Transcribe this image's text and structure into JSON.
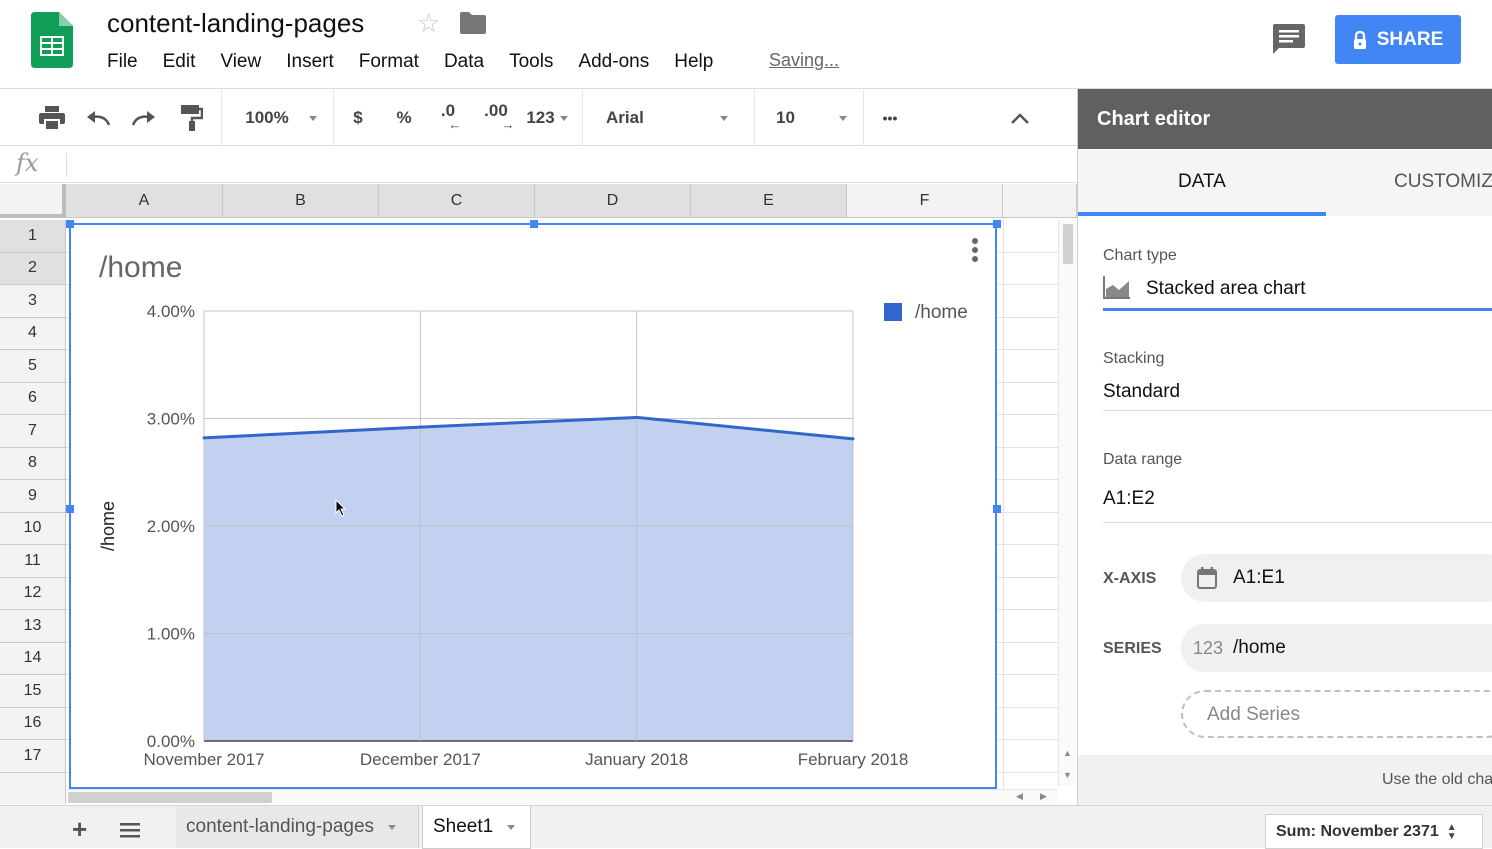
{
  "app": {
    "title": "content-landing-pages",
    "saving_text": "Saving...",
    "share_label": "SHARE",
    "menu": [
      "File",
      "Edit",
      "View",
      "Insert",
      "Format",
      "Data",
      "Tools",
      "Add-ons",
      "Help"
    ]
  },
  "toolbar": {
    "zoom": "100%",
    "currency": "$",
    "percent": "%",
    "decrease_decimal": ".0",
    "increase_decimal": ".00",
    "number_format": "123",
    "font": "Arial",
    "font_size": "10",
    "more": "•••"
  },
  "formula_bar": {
    "fx": "fx"
  },
  "grid": {
    "columns": [
      "A",
      "B",
      "C",
      "D",
      "E",
      "F"
    ],
    "rows": [
      "1",
      "2",
      "3",
      "4",
      "5",
      "6",
      "7",
      "8",
      "9",
      "10",
      "11",
      "12",
      "13",
      "14",
      "15",
      "16",
      "17"
    ]
  },
  "chart_data": {
    "type": "area",
    "title": "/home",
    "ylabel": "/home",
    "xlabel": "",
    "categories": [
      "November 2017",
      "December 2017",
      "January 2018",
      "February 2018"
    ],
    "series": [
      {
        "name": "/home",
        "values": [
          0.0282,
          0.0292,
          0.0301,
          0.0281
        ],
        "color": "#3366cc"
      }
    ],
    "ylim": [
      0,
      0.04
    ],
    "yticks": [
      "0.00%",
      "1.00%",
      "2.00%",
      "3.00%",
      "4.00%"
    ],
    "grid": true,
    "legend": "top-right",
    "stacked": true
  },
  "sheets": {
    "tabs": [
      {
        "label": "content-landing-pages",
        "active": false
      },
      {
        "label": "Sheet1",
        "active": true
      }
    ],
    "sum_text": "Sum: November 2371"
  },
  "editor": {
    "title": "Chart editor",
    "tab_data": "DATA",
    "tab_customize": "CUSTOMIZ",
    "chart_type_label": "Chart type",
    "chart_type_value": "Stacked area chart",
    "stacking_label": "Stacking",
    "stacking_value": "Standard",
    "data_range_label": "Data range",
    "data_range_value": "A1:E2",
    "xaxis_label": "X-AXIS",
    "xaxis_value": "A1:E1",
    "series_label": "SERIES",
    "series_icon_text": "123",
    "series_value": "/home",
    "add_series": "Add Series",
    "footer_text": "Use the old cha"
  },
  "colors": {
    "accent": "#4285f4",
    "series": "#3366cc",
    "area_fill": "#c3d1f0",
    "sheets_green": "#0f9d58"
  }
}
